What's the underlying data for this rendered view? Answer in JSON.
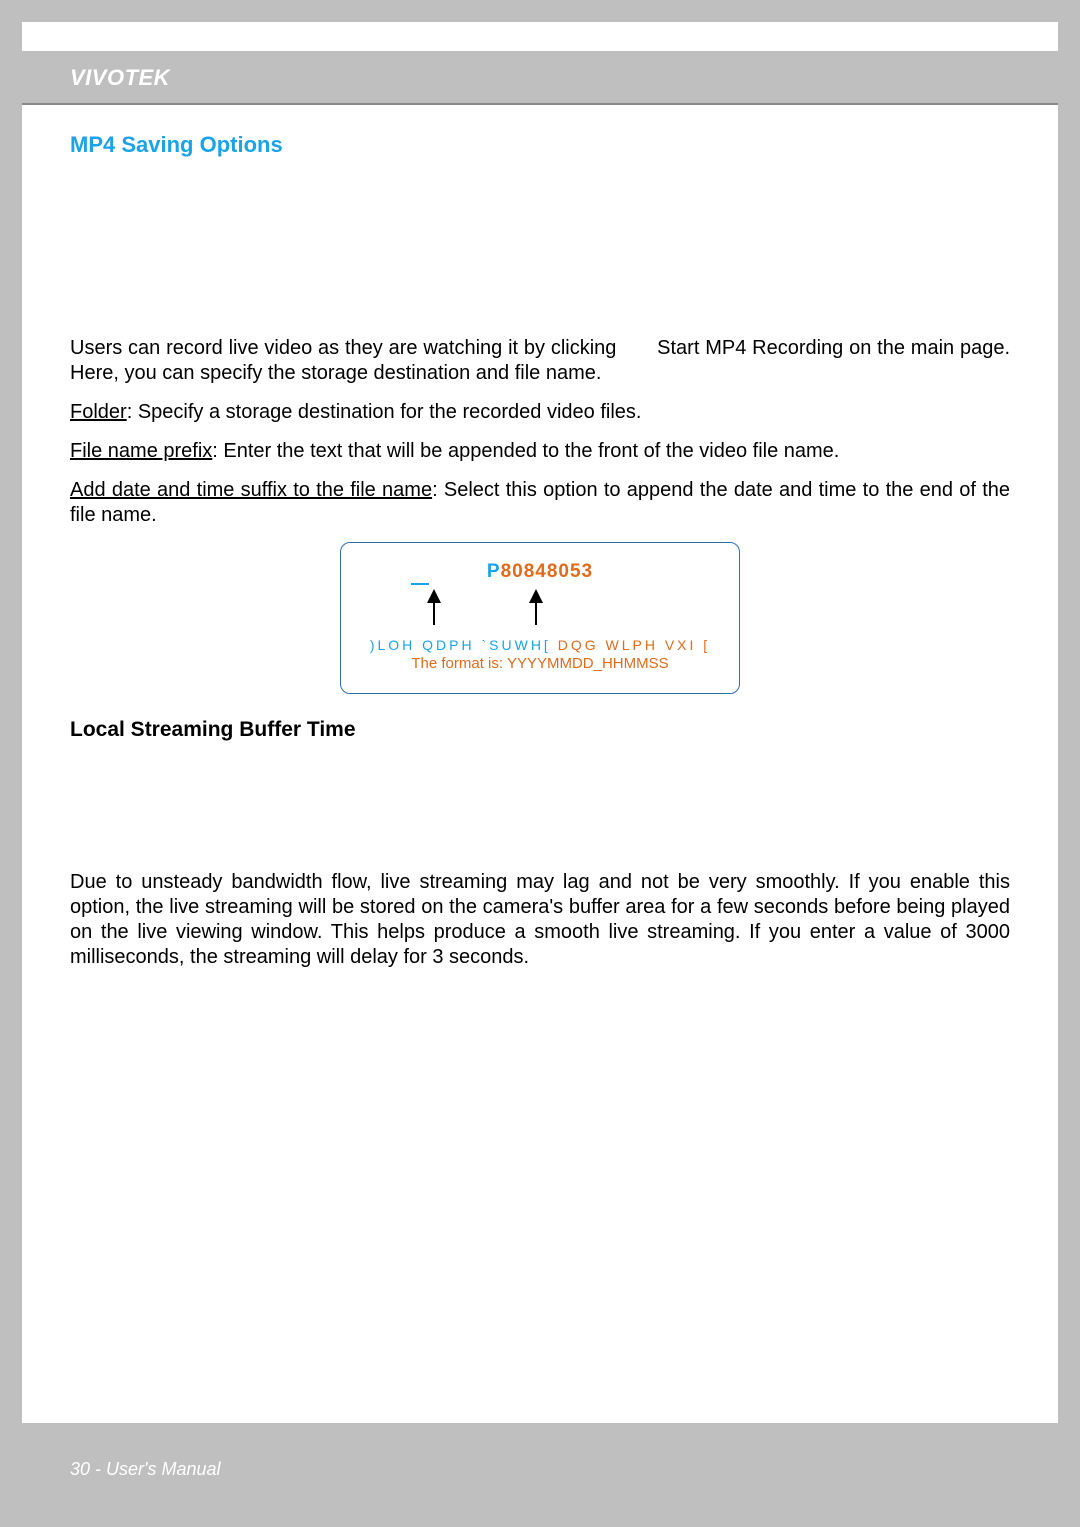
{
  "header": {
    "brand": "VIVOTEK"
  },
  "sections": {
    "mp4": {
      "title": "MP4 Saving Options",
      "intro_a": "Users can record live video as they are watching it by clicking",
      "intro_b": "Start MP4 Recording on the main page. Here, you can specify the storage destination and file name.",
      "folder_label": "Folder",
      "folder_text": ": Specify a storage destination for the recorded video files.",
      "prefix_label": "File name prefix",
      "prefix_text": ": Enter the text that will be appended to the front of the video file name.",
      "suffix_label": "Add date and time suffix to the file name",
      "suffix_text": ": Select this option to append the date and time to the end of the file name."
    },
    "diagram": {
      "code_prefix": "P",
      "code_rest": "80848053",
      "line1_blue": ")LOH QDPH `SUWH[",
      "line1_orange": "DQG WLPH VXI [",
      "line2": "The format is: YYYYMMDD_HHMMSS"
    },
    "buffer": {
      "title": "Local Streaming Buffer Time",
      "body": "Due to unsteady bandwidth flow, live streaming may lag and not be very smoothly. If you enable this option, the live streaming will be stored on the camera's buffer area for a few seconds before being played on the live viewing window. This helps produce a smooth live streaming. If you enter a value of 3000 milliseconds, the streaming will delay for 3 seconds."
    }
  },
  "footer": {
    "page": "30 - User's Manual"
  }
}
